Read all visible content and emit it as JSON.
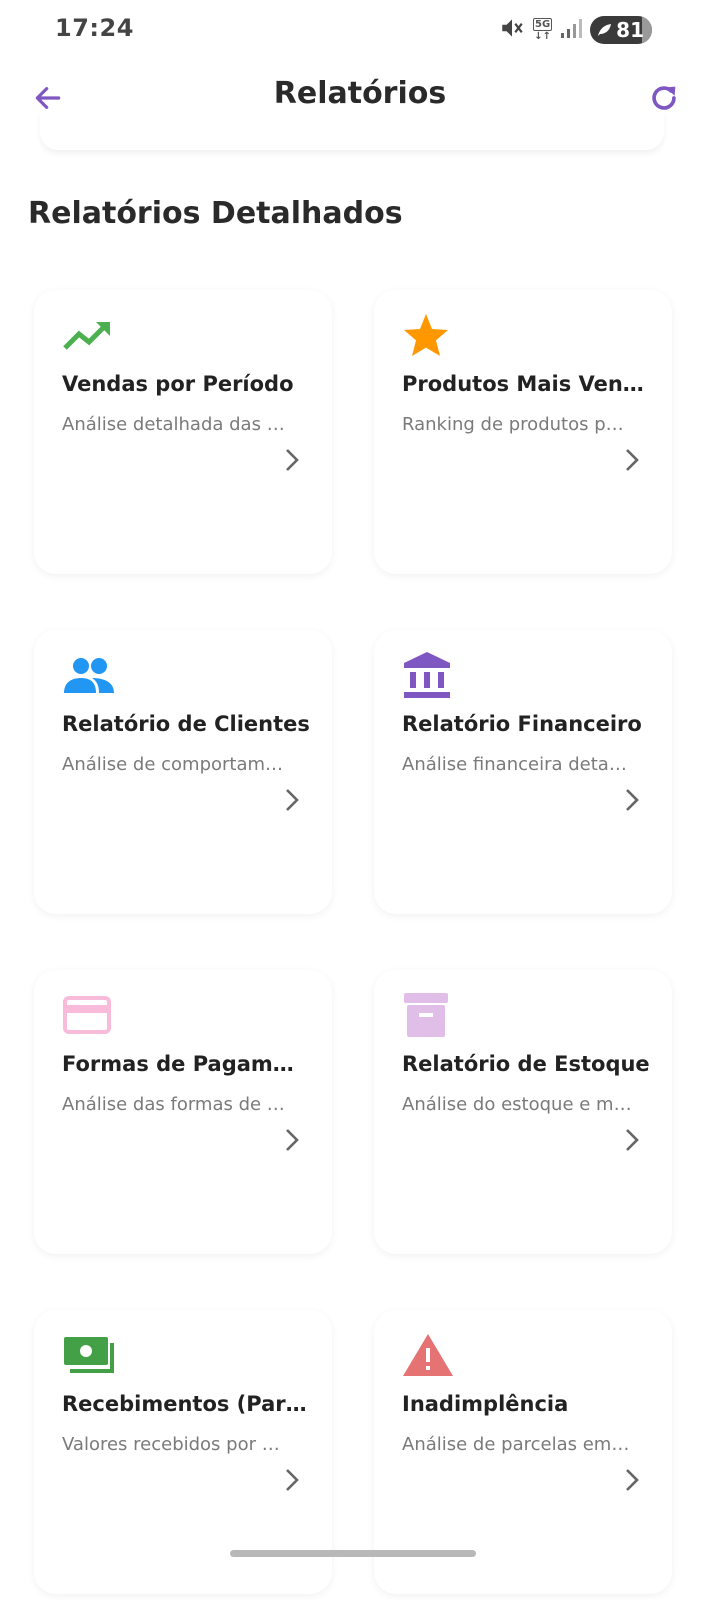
{
  "status_bar": {
    "time": "17:24",
    "network": "5G",
    "battery": "81",
    "icons": [
      "mute-icon",
      "5g-icon",
      "signal-icon",
      "battery-icon"
    ]
  },
  "app_bar": {
    "title": "Relatórios",
    "back_icon": "arrow-left-icon",
    "refresh_icon": "refresh-icon"
  },
  "section": {
    "title": "Relatórios Detalhados"
  },
  "cards": [
    {
      "title": "Vendas por Período",
      "subtitle": "Análise detalhada das …",
      "icon": "trending-up-icon",
      "icon_color": "#4caf50"
    },
    {
      "title": "Produtos Mais Ven…",
      "subtitle": "Ranking de produtos p…",
      "icon": "star-icon",
      "icon_color": "#ff9800"
    },
    {
      "title": "Relatório de Clientes",
      "subtitle": "Análise de comportam…",
      "icon": "people-icon",
      "icon_color": "#2196f3"
    },
    {
      "title": "Relatório Financeiro",
      "subtitle": "Análise financeira deta…",
      "icon": "bank-icon",
      "icon_color": "#7e57c2"
    },
    {
      "title": "Formas de Pagam…",
      "subtitle": "Análise das formas de …",
      "icon": "credit-card-icon",
      "icon_color": "#f8bbd9"
    },
    {
      "title": "Relatório de Estoque",
      "subtitle": "Análise do estoque e m…",
      "icon": "inventory-icon",
      "icon_color": "#e1bee7"
    },
    {
      "title": "Recebimentos (Par…",
      "subtitle": "Valores recebidos por …",
      "icon": "money-icon",
      "icon_color": "#43a047"
    },
    {
      "title": "Inadimplência",
      "subtitle": "Análise de parcelas em…",
      "icon": "warning-icon",
      "icon_color": "#e57373"
    }
  ],
  "colors": {
    "accent": "#7e57c2",
    "title_text": "#2a2a2a",
    "subtitle_text": "#7a7a7a"
  }
}
